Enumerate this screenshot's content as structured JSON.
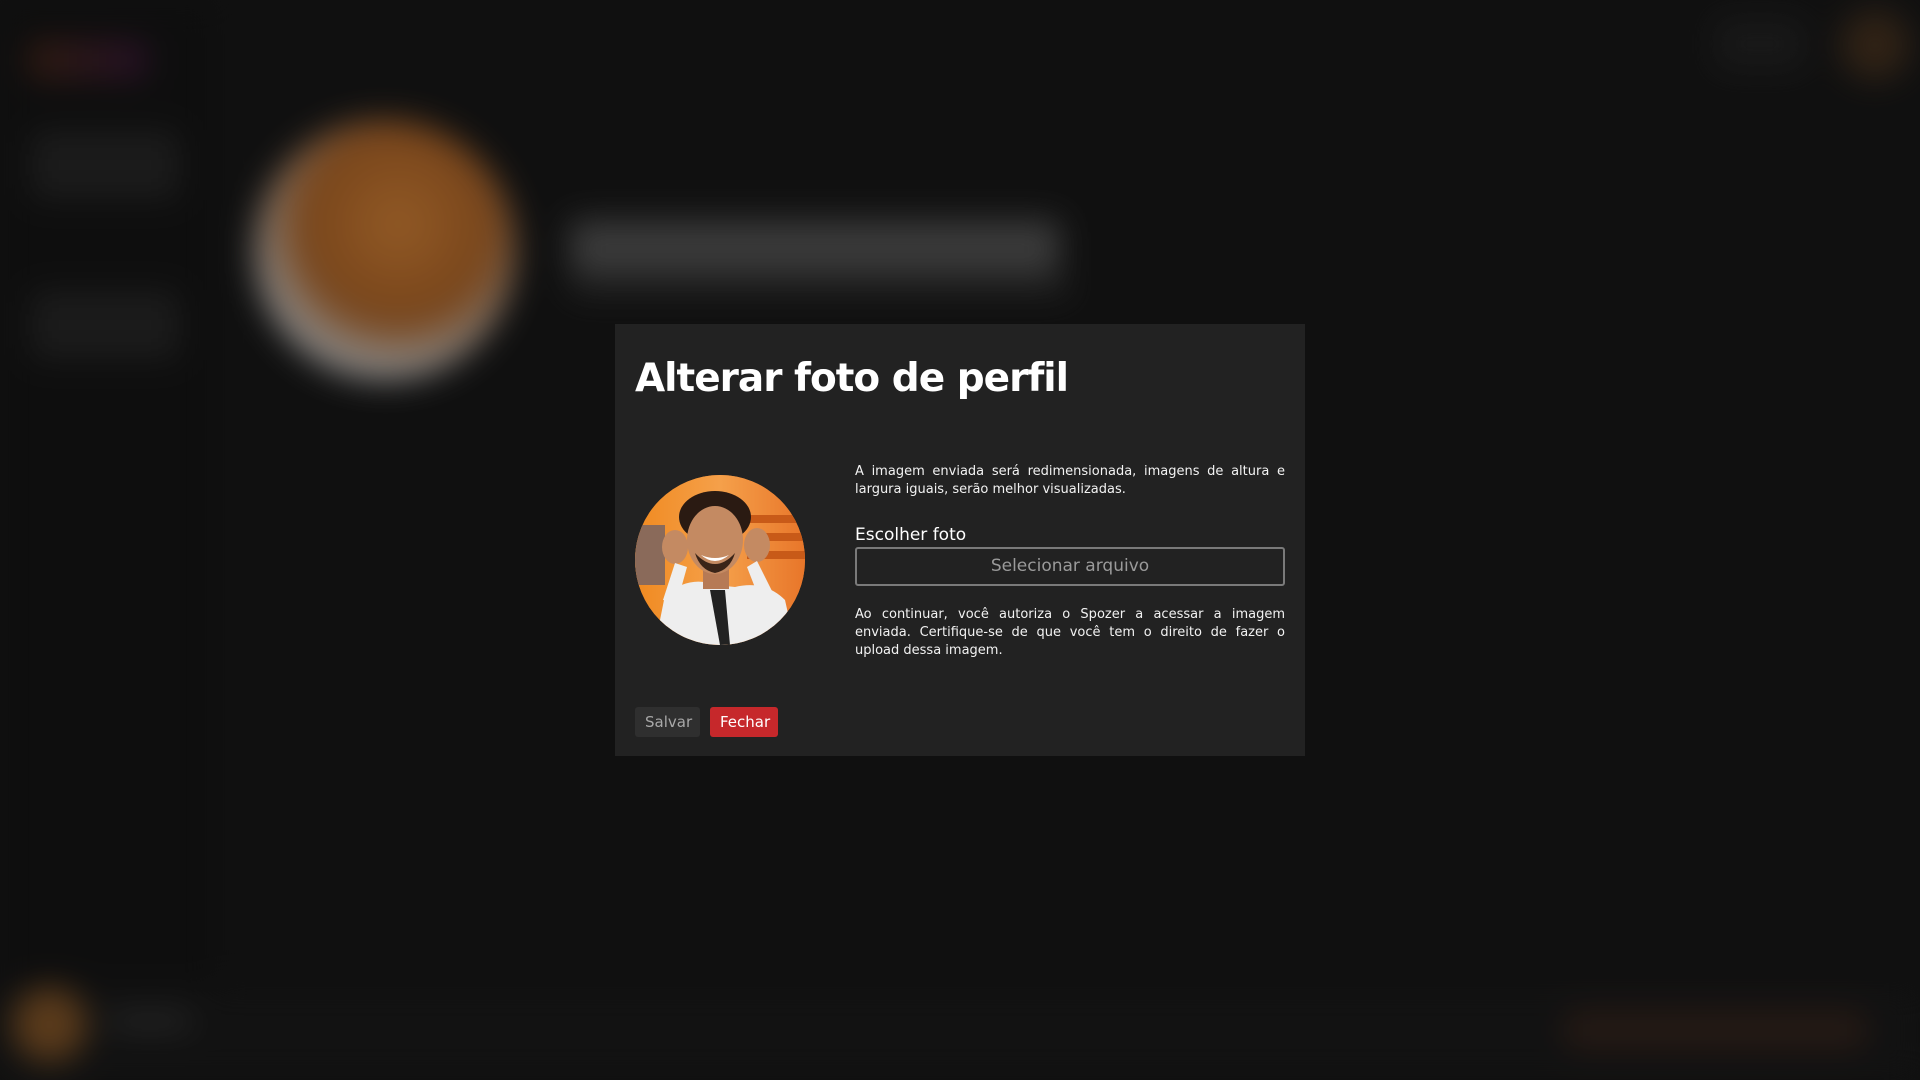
{
  "modal": {
    "title": "Alterar foto de perfil",
    "info_text": "A imagem enviada será redimensionada, imagens de altura e largura iguais, serão melhor visualizadas.",
    "file_label": "Escolher foto",
    "file_button": "Selecionar arquivo",
    "consent_text": "Ao continuar, você autoriza o Spozer a acessar a imagem enviada. Certifique-se de que você tem o direito de fazer o upload dessa imagem.",
    "save_label": "Salvar",
    "close_label": "Fechar"
  },
  "colors": {
    "modal_bg": "#222222",
    "close_button": "#c6282b",
    "save_button": "#2f2f2f"
  },
  "icons": {
    "avatar_preview": "profile-photo"
  }
}
